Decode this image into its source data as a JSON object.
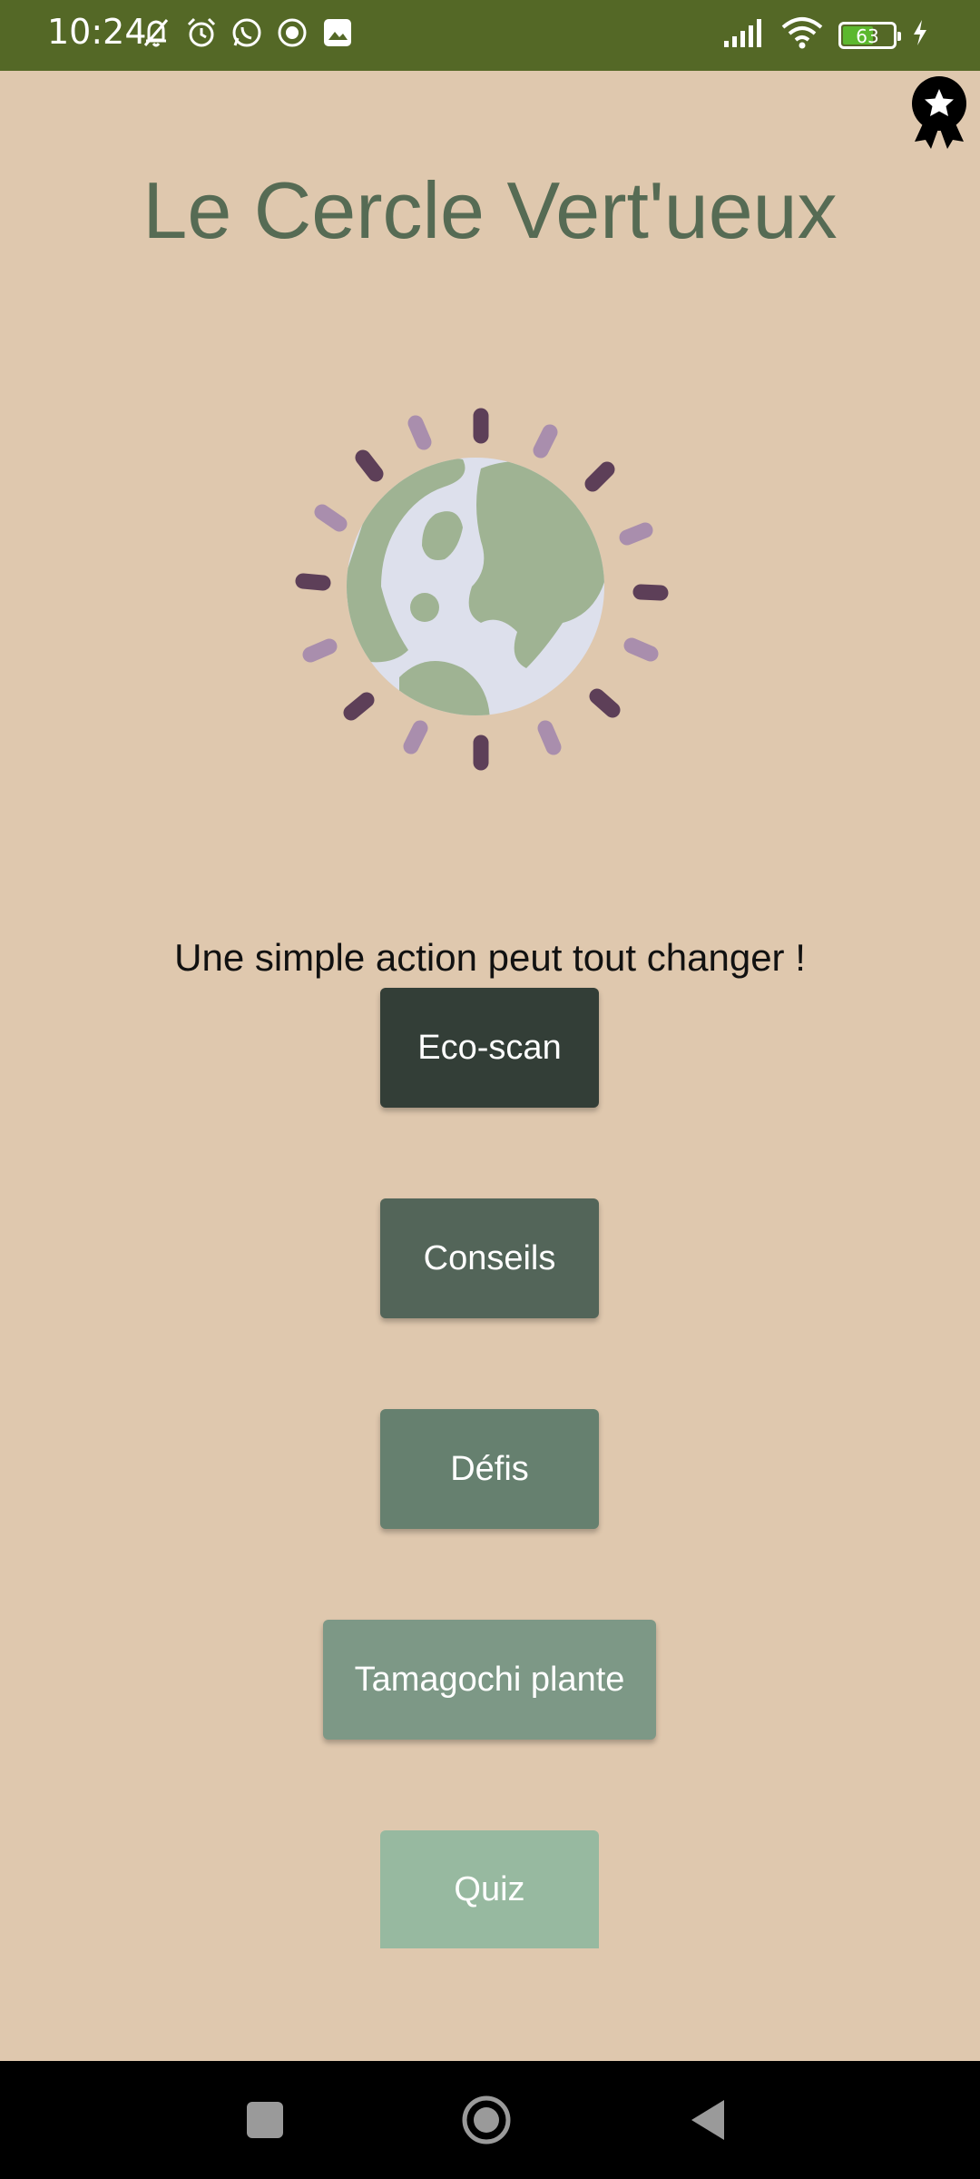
{
  "status_bar": {
    "time": "10:24",
    "battery_level": "63",
    "battery_percent": 63,
    "colors": {
      "background": "#546826",
      "battery_fill": "#5cb82e"
    },
    "left_icons": [
      "bell-off-icon",
      "alarm-icon",
      "whatsapp-icon",
      "record-icon",
      "photo-icon"
    ],
    "right_icons": [
      "signal-icon",
      "wifi-icon",
      "battery-icon",
      "charging-icon"
    ]
  },
  "header": {
    "title": "Le Cercle Vert'ueux",
    "award_icon": "award-badge-icon"
  },
  "logo": {
    "icon": "globe-sunburst-icon"
  },
  "main": {
    "tagline": "Une simple action peut tout changer !",
    "buttons": [
      {
        "label": "Eco-scan",
        "color": "#333e37"
      },
      {
        "label": "Conseils",
        "color": "#536559"
      },
      {
        "label": "Défis",
        "color": "#66806f"
      },
      {
        "label": "Tamagochi plante",
        "color": "#7d9886"
      },
      {
        "label": "Quiz",
        "color": "#97b9a0"
      }
    ]
  },
  "nav_bar": {
    "icons": [
      "recents-icon",
      "home-icon",
      "back-icon"
    ]
  },
  "colors": {
    "background": "#dfc8ae",
    "title": "#566b54",
    "globe_land": "#9fb393",
    "globe_water": "#dde0ec",
    "ray_dark": "#5d3f58",
    "ray_light": "#a98ead"
  }
}
